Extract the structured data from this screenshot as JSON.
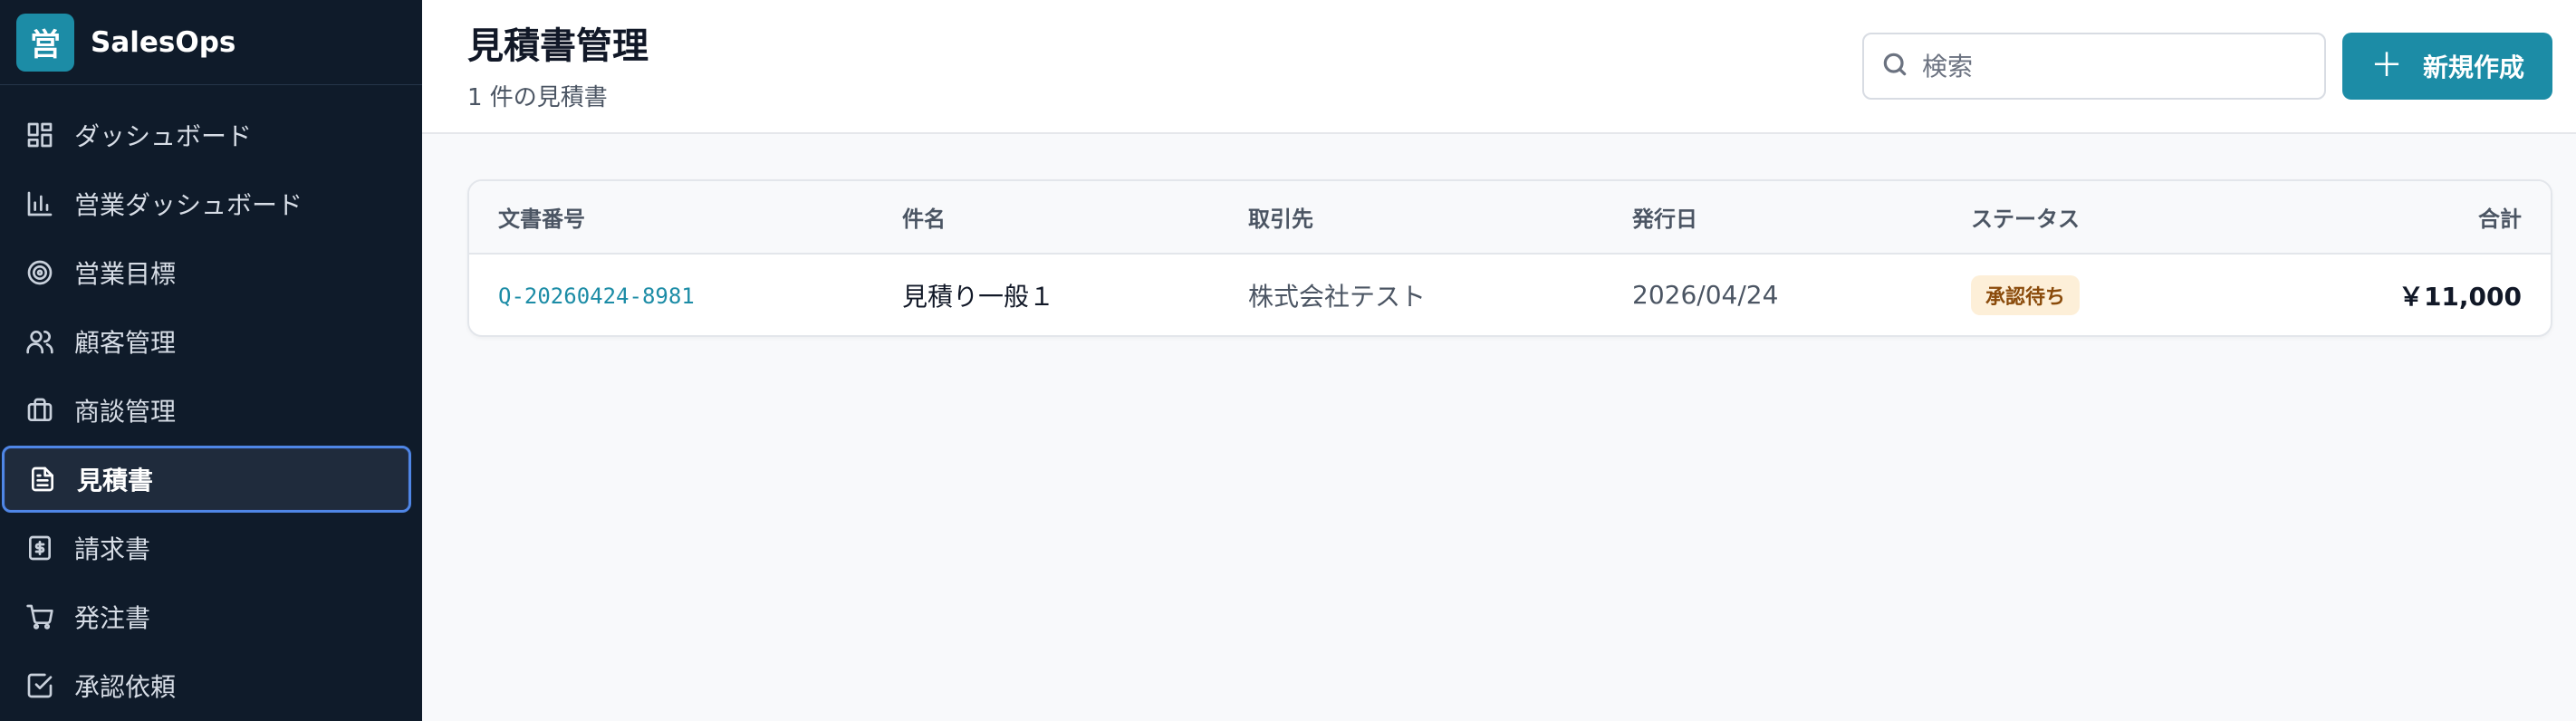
{
  "brand": {
    "logo_char": "営",
    "name": "SalesOps"
  },
  "sidebar": {
    "items": [
      {
        "label": "ダッシュボード",
        "icon": "dashboard-icon"
      },
      {
        "label": "営業ダッシュボード",
        "icon": "bar-chart-icon"
      },
      {
        "label": "営業目標",
        "icon": "target-icon"
      },
      {
        "label": "顧客管理",
        "icon": "users-icon"
      },
      {
        "label": "商談管理",
        "icon": "briefcase-icon"
      },
      {
        "label": "見積書",
        "icon": "document-icon",
        "active": true
      },
      {
        "label": "請求書",
        "icon": "invoice-icon"
      },
      {
        "label": "発注書",
        "icon": "cart-icon"
      },
      {
        "label": "承認依頼",
        "icon": "check-square-icon"
      }
    ]
  },
  "header": {
    "title": "見積書管理",
    "subtitle": "1 件の見積書",
    "search_placeholder": "検索",
    "new_button_label": "新規作成",
    "new_button_icon": "＋"
  },
  "table": {
    "columns": [
      "文書番号",
      "件名",
      "取引先",
      "発行日",
      "ステータス",
      "合計"
    ],
    "rows": [
      {
        "doc_no": "Q-20260424-8981",
        "subject": "見積り一般１",
        "client": "株式会社テスト",
        "date": "2026/04/24",
        "status": "承認待ち",
        "total": "￥11,000"
      }
    ]
  },
  "colors": {
    "accent": "#1c8ca6",
    "sidebar_bg": "#0f1b2a",
    "active_border": "#4f86e6",
    "badge_bg": "#fdefd8",
    "badge_text": "#8a4b0b"
  }
}
